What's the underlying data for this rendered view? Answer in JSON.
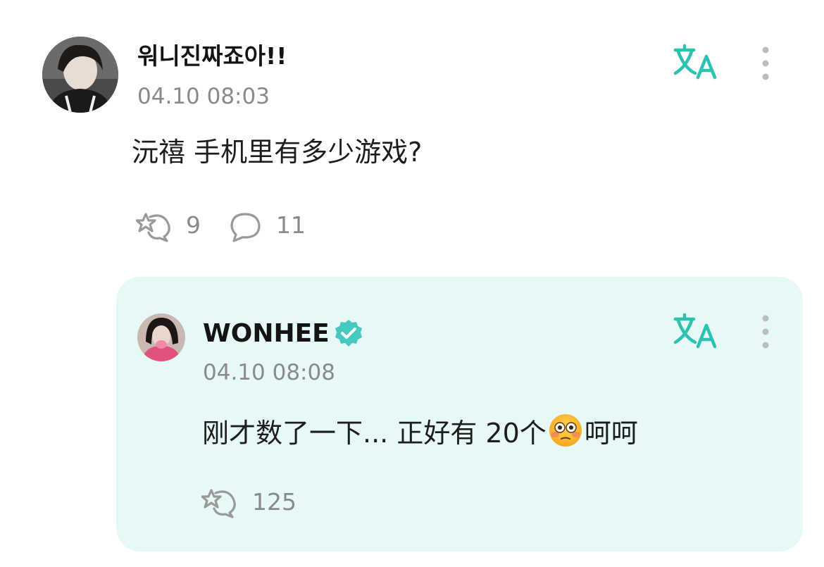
{
  "post": {
    "author": "워니진짜죠아!!",
    "time": "04.10 08:03",
    "text": "沅禧 手机里有多少游戏?",
    "likes": "9",
    "comments": "11",
    "avatar_icon": "user-photo-dark-hair",
    "translate_icon": "translate-icon",
    "more_icon": "vertical-dots-icon"
  },
  "reply": {
    "author": "WONHEE",
    "verified_icon": "verified-badge-icon",
    "time": "04.10 08:08",
    "text_before_emoji": "刚才数了一下... 正好有 20个",
    "emoji": "flushed-face-emoji",
    "text_after_emoji": "呵呵",
    "likes": "125",
    "card_color": "#e6f9f6"
  },
  "colors": {
    "accent": "#2cc2b2",
    "muted": "#8a8a8a",
    "verified": "#46c9c1"
  }
}
